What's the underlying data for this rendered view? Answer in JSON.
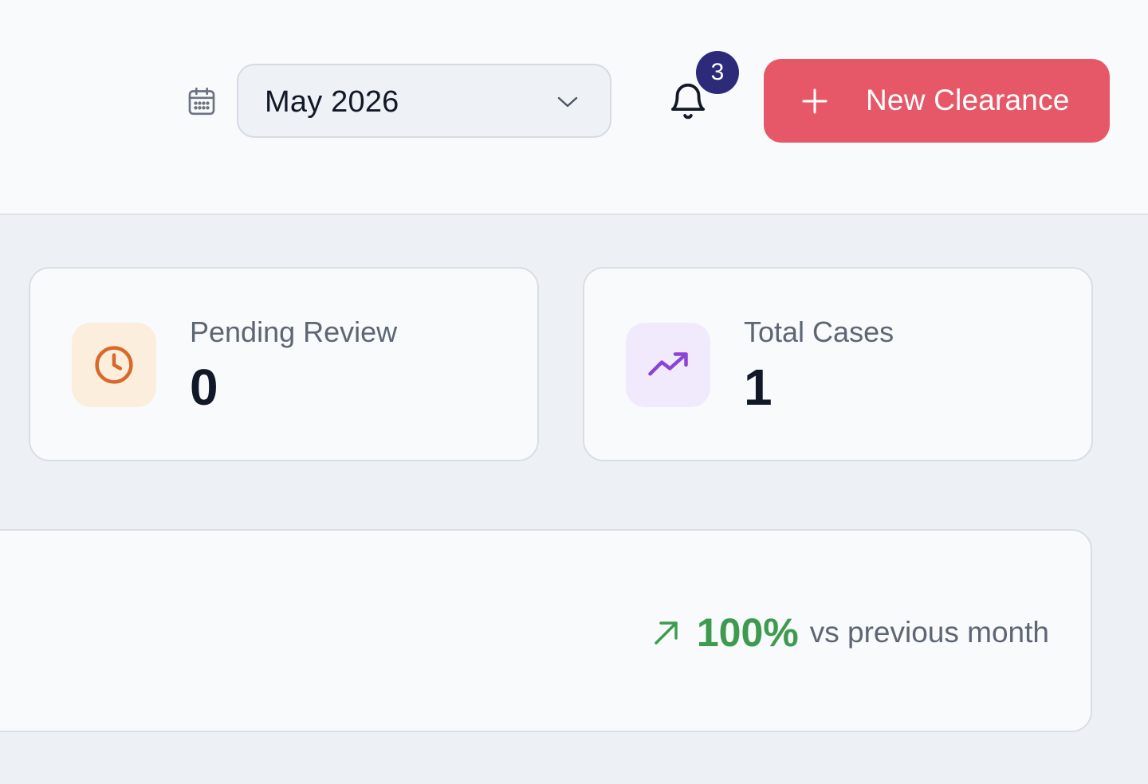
{
  "header": {
    "calendar_icon": "calendar-icon",
    "month_select": {
      "value": "May 2026",
      "icon": "chevron-down-icon"
    },
    "notifications": {
      "icon": "bell-icon",
      "badge_count": "3"
    },
    "new_clearance_button": {
      "icon": "plus-icon",
      "label": "New Clearance"
    }
  },
  "stats": [
    {
      "label": "Pending Review",
      "value": "0",
      "icon": "clock-icon",
      "icon_color": "#d9692a",
      "icon_bg": "#fbeedd"
    },
    {
      "label": "Total Cases",
      "value": "1",
      "icon": "trending-up-icon",
      "icon_color": "#8b45d6",
      "icon_bg": "#f1eafd"
    }
  ],
  "trend": {
    "icon": "arrow-up-right-icon",
    "percent": "100%",
    "caption": "vs previous month",
    "color": "#3e9a4f"
  },
  "colors": {
    "accent": "#e65867",
    "badge": "#2d2a7a",
    "page_bg": "#edf1f6",
    "surface": "#f8fafc"
  }
}
